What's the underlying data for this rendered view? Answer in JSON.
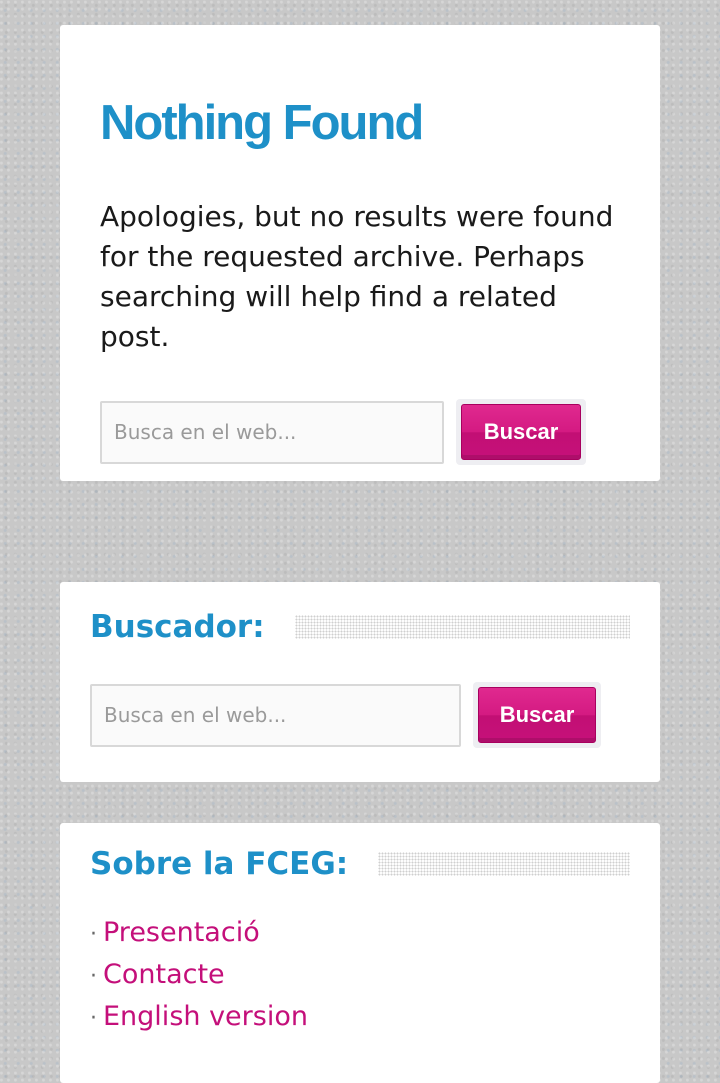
{
  "results": {
    "title": "Nothing Found",
    "message": "Apologies, but no results were found for the requested archive. Perhaps searching will help find a related post.",
    "search": {
      "placeholder": "Busca en el web...",
      "button_label": "Buscar"
    }
  },
  "search_widget": {
    "title": "Buscador:",
    "search": {
      "placeholder": "Busca en el web...",
      "button_label": "Buscar"
    }
  },
  "about_widget": {
    "title": "Sobre la FCEG:",
    "bullet": "·",
    "links": [
      {
        "label": "Presentació"
      },
      {
        "label": "Contacte"
      },
      {
        "label": "English version"
      }
    ]
  },
  "colors": {
    "heading": "#1e90c8",
    "accent": "#c40f7a",
    "background": "#c8c8c8",
    "panel": "#ffffff"
  }
}
